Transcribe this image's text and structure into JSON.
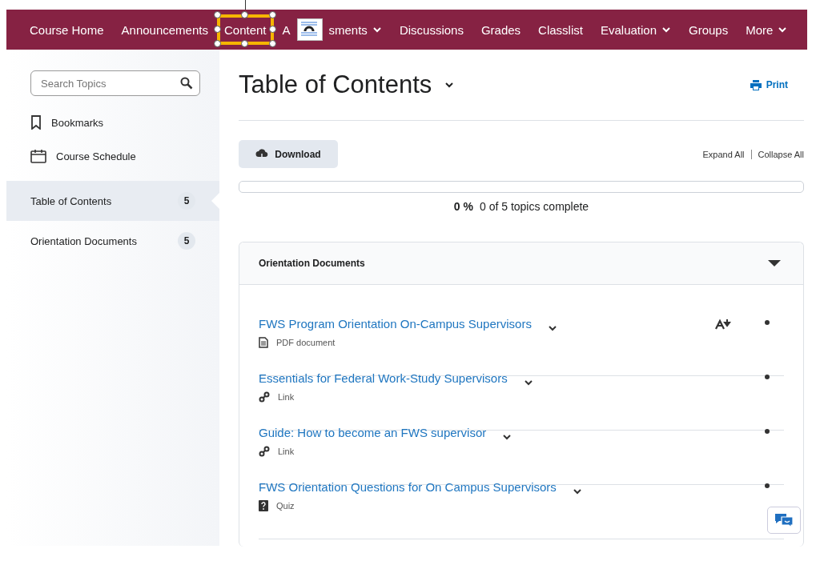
{
  "nav": {
    "items": [
      {
        "label": "Course Home",
        "selected": false,
        "dropdown": false
      },
      {
        "label": "Announcements",
        "selected": false,
        "dropdown": false
      },
      {
        "label": "Content",
        "selected": true,
        "dropdown": false
      },
      {
        "label_parts": [
          "A",
          "sments"
        ],
        "selected": false,
        "dropdown": true
      },
      {
        "label": "Discussions",
        "selected": false,
        "dropdown": false
      },
      {
        "label": "Grades",
        "selected": false,
        "dropdown": false
      },
      {
        "label": "Classlist",
        "selected": false,
        "dropdown": false
      },
      {
        "label": "Evaluation",
        "selected": false,
        "dropdown": true
      },
      {
        "label": "Groups",
        "selected": false,
        "dropdown": false
      },
      {
        "label": "More",
        "selected": false,
        "dropdown": true
      }
    ]
  },
  "sidebar": {
    "search": {
      "placeholder": "Search Topics"
    },
    "links": [
      {
        "label": "Bookmarks",
        "kind": "bookmark"
      },
      {
        "label": "Course Schedule",
        "kind": "calendar"
      }
    ],
    "modules": [
      {
        "label": "Table of Contents",
        "count": "5",
        "selected": true
      },
      {
        "label": "Orientation Documents",
        "count": "5",
        "selected": false
      }
    ]
  },
  "main": {
    "title": "Table of Contents",
    "print": "Print",
    "download": "Download",
    "expand_all": "Expand All",
    "collapse_all": "Collapse All",
    "progress": {
      "level": 0,
      "percent": "0 %",
      "summary": "0 of 5 topics complete"
    },
    "module": {
      "title": "Orientation Documents",
      "expanded": true,
      "topics": [
        {
          "title": "FWS Program Orientation On-Campus Supervisors",
          "kind": "pdf",
          "type_label": "PDF document",
          "flagged": true
        },
        {
          "title": "Essentials for Federal Work-Study Supervisors",
          "kind": "link",
          "type_label": "Link",
          "flagged": false
        },
        {
          "title": "Guide: How to become an FWS supervisor",
          "kind": "link",
          "type_label": "Link",
          "flagged": false
        },
        {
          "title": "FWS Orientation Questions for On Campus Supervisors",
          "kind": "quiz",
          "type_label": "Quiz",
          "flagged": false
        }
      ]
    }
  }
}
